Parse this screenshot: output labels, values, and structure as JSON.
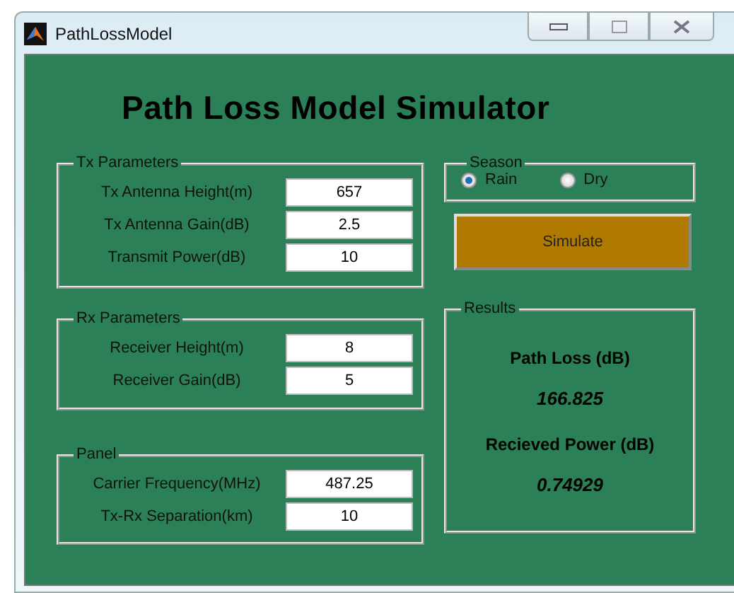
{
  "window": {
    "title": "PathLossModel"
  },
  "heading": "Path Loss Model Simulator",
  "parameter_groups": [
    {
      "legend": "Tx Parameters",
      "fields": [
        {
          "label": "Tx Antenna Height(m)",
          "value": "657"
        },
        {
          "label": "Tx Antenna Gain(dB)",
          "value": "2.5"
        },
        {
          "label": "Transmit Power(dB)",
          "value": "10"
        }
      ]
    },
    {
      "legend": "Rx Parameters",
      "fields": [
        {
          "label": "Receiver Height(m)",
          "value": "8"
        },
        {
          "label": "Receiver Gain(dB)",
          "value": "5"
        }
      ]
    },
    {
      "legend": "Panel",
      "fields": [
        {
          "label": "Carrier Frequency(MHz)",
          "value": "487.25"
        },
        {
          "label": "Tx-Rx Separation(km)",
          "value": "10"
        }
      ]
    }
  ],
  "season": {
    "legend": "Season",
    "options": [
      {
        "label": "Rain",
        "selected": true
      },
      {
        "label": "Dry",
        "selected": false
      }
    ]
  },
  "simulate_button": "Simulate",
  "results": {
    "legend": "Results",
    "items": [
      {
        "label": "Path Loss (dB)",
        "value": "166.825"
      },
      {
        "label": "Recieved Power (dB)",
        "value": "0.74929"
      }
    ]
  }
}
